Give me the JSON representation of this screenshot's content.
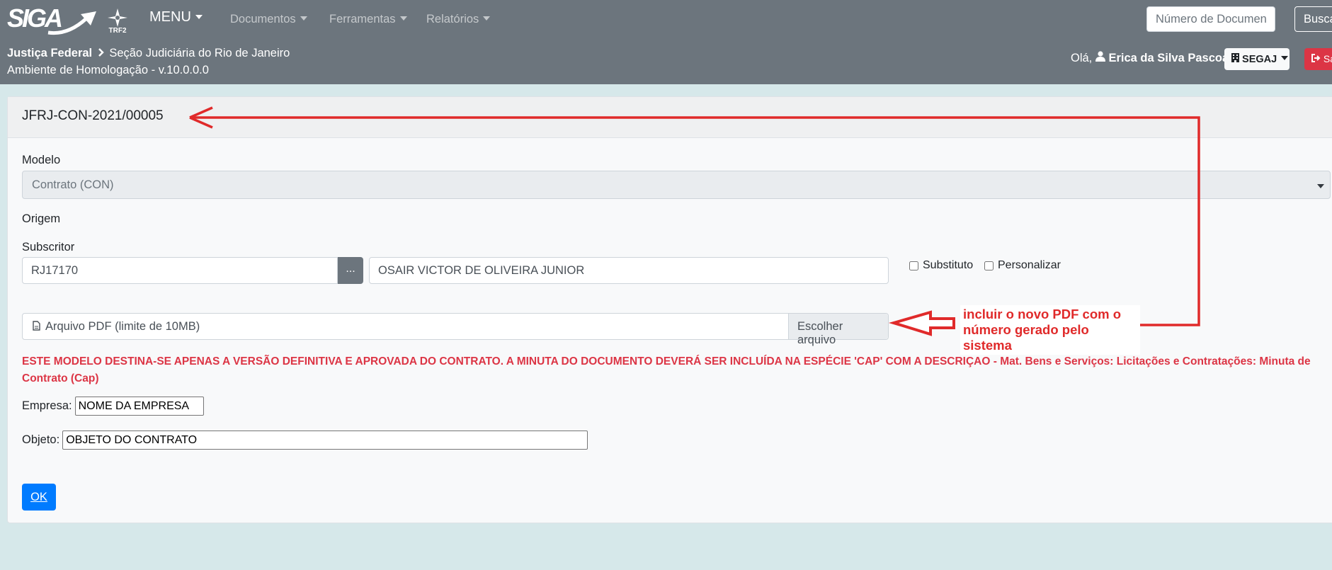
{
  "header": {
    "logo_text": "SIGA",
    "org_logo_label": "TRF2",
    "menu_label": "MENU",
    "nav": [
      "Documentos",
      "Ferramentas",
      "Relatórios"
    ],
    "search_placeholder": "Número de Documento",
    "search_button": "Buscar",
    "breadcrumb_root": "Justiça Federal",
    "breadcrumb_section": "Seção Judiciária do Rio de Janeiro",
    "environment": "Ambiente de Homologação - v.10.0.0.0",
    "greeting": "Olá,",
    "user_name": "Erica da Silva Pascoal",
    "unit_label": "SEGAJ",
    "logout_label": "Sair"
  },
  "form": {
    "doc_code": "JFRJ-CON-2021/00005",
    "modelo_label": "Modelo",
    "modelo_value": "Contrato (CON)",
    "origem_label": "Origem",
    "subscritor_label": "Subscritor",
    "subscritor_code": "RJ17170",
    "lookup_button": "...",
    "subscritor_name": "OSAIR VICTOR DE OLIVEIRA JUNIOR",
    "substituto_label": "Substituto",
    "personalizar_label": "Personalizar",
    "file_label": "Arquivo PDF (limite de 10MB)",
    "file_button": "Escolher arquivo",
    "warning": "ESTE MODELO DESTINA-SE APENAS A VERSÃO DEFINITIVA E APROVADA DO CONTRATO. A MINUTA DO DOCUMENTO DEVERÁ SER INCLUÍDA NA ESPÉCIE 'CAP' COM A DESCRIÇAO - Mat. Bens e Serviços: Licitações e Contratações: Minuta de Contrato (Cap)",
    "empresa_label": "Empresa:",
    "empresa_value": "NOME DA EMPRESA",
    "objeto_label": "Objeto:",
    "objeto_value": "OBJETO DO CONTRATO",
    "ok_button": "OK"
  },
  "annotation": {
    "note": "incluir o novo PDF com o número gerado pelo sistema",
    "color": "#e02a2a"
  },
  "colors": {
    "header_bg": "#6c757d",
    "page_bg": "#d6e8ea",
    "primary": "#007bff",
    "danger": "#dc3545"
  }
}
